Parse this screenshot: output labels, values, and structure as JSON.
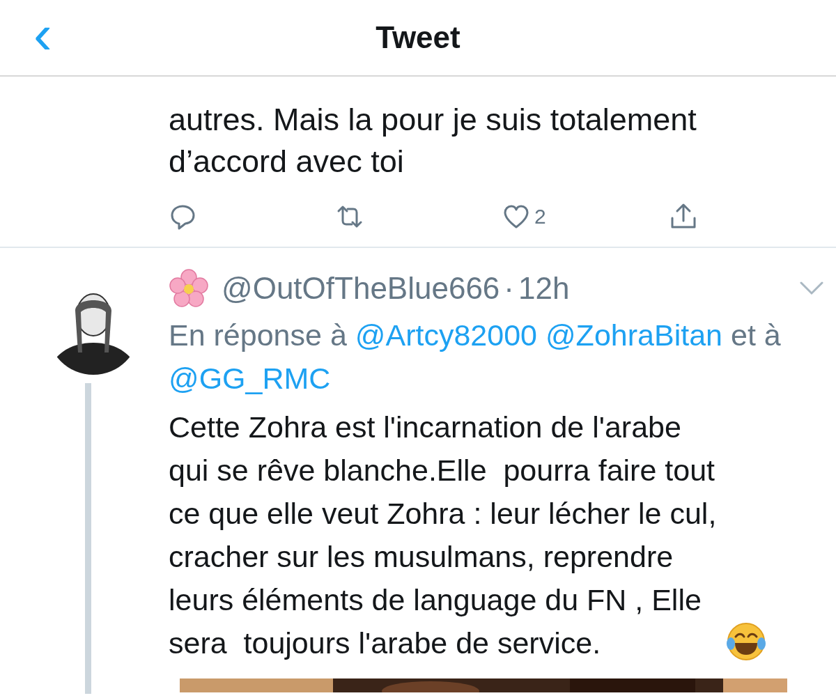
{
  "header": {
    "back": "‹",
    "title": "Tweet"
  },
  "previous_tweet": {
    "lines": [
      "autres. Mais la pour je suis totalement",
      "d’accord avec toi"
    ],
    "actions": [
      {
        "kind": "reply"
      },
      {
        "kind": "retweet"
      },
      {
        "kind": "like",
        "count": "2"
      },
      {
        "kind": "share"
      }
    ]
  },
  "reply_tweet": {
    "handle": "@OutOfTheBlue666",
    "separator": "·",
    "time": "12h",
    "reply_to": [
      {
        "kind": "plain",
        "text": "En réponse à"
      },
      {
        "kind": "mention",
        "text": "@Artcy82000"
      },
      {
        "kind": "mention",
        "text": "@ZohraBitan"
      },
      {
        "kind": "plain",
        "text": "et à"
      },
      {
        "kind": "mention",
        "text": "@GG_RMC"
      }
    ],
    "lines": [
      "Cette Zohra est l'incarnation de l'arabe",
      "qui se rêve blanche.Elle  pourra faire tout",
      "ce que elle veut Zohra : leur lécher le cul,",
      "cracher sur les musulmans, reprendre",
      "leurs éléments de language du FN , Elle",
      "sera  toujours l'arabe de service."
    ]
  }
}
